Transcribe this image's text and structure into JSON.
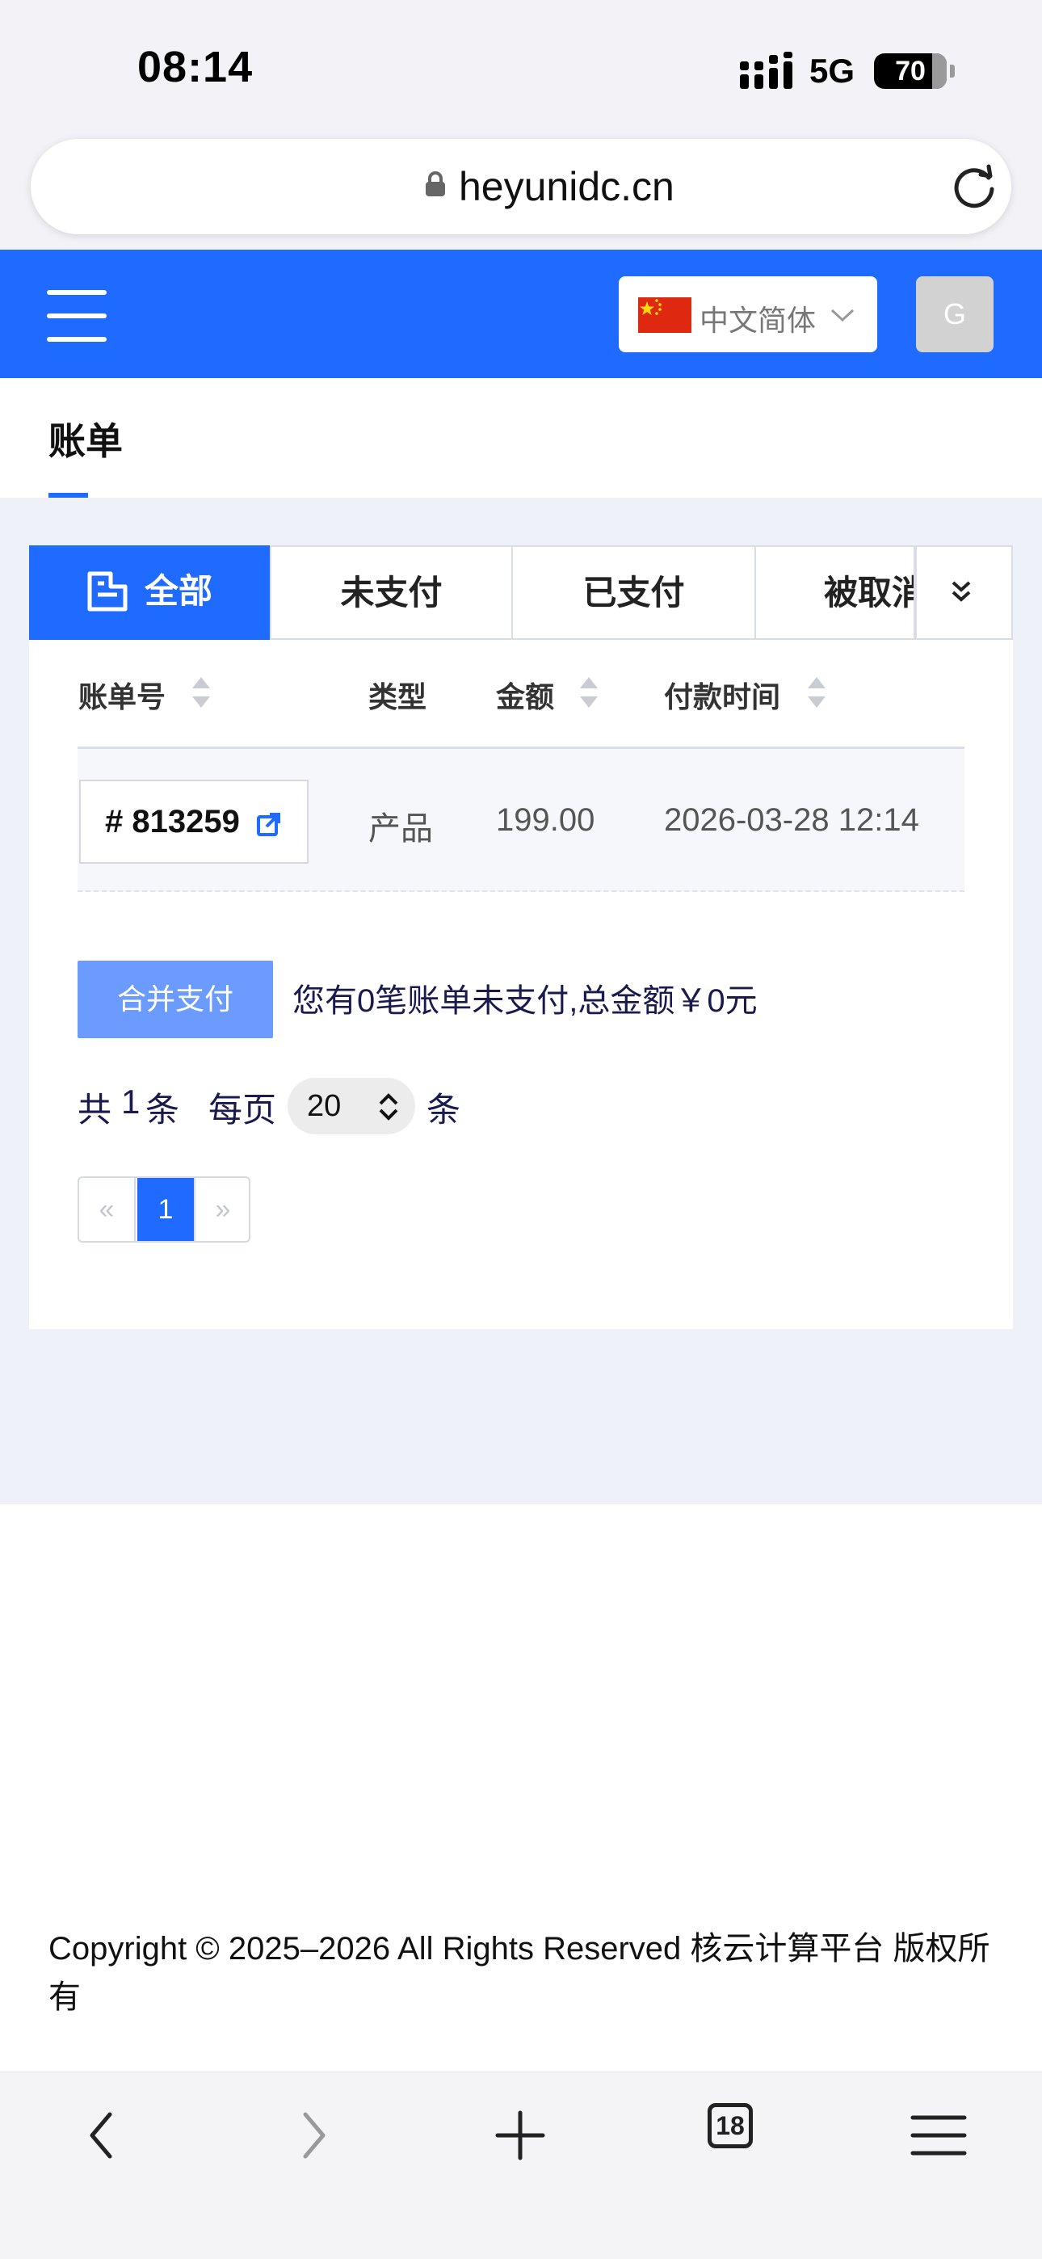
{
  "status_bar": {
    "time": "08:14",
    "network": "5G",
    "battery": "70"
  },
  "browser": {
    "url": "heyunidc.cn",
    "tab_count": "18"
  },
  "header": {
    "language": "中文简体",
    "avatar_initial": "G"
  },
  "page": {
    "title": "账单"
  },
  "tabs": [
    {
      "label": "全部",
      "active": true
    },
    {
      "label": "未支付",
      "active": false
    },
    {
      "label": "已支付",
      "active": false
    },
    {
      "label": "被取消",
      "active": false
    }
  ],
  "table": {
    "headers": {
      "bill_no": "账单号",
      "type": "类型",
      "amount": "金额",
      "pay_time": "付款时间"
    },
    "rows": [
      {
        "bill_no": "# 813259",
        "type": "产品",
        "amount": "199.00",
        "pay_time": "2026-03-28 12:14"
      }
    ]
  },
  "summary": {
    "merge_button": "合并支付",
    "unpaid_note": "您有0笔账单未支付,总金额￥0元"
  },
  "pagination": {
    "total_prefix": "共",
    "total": "1",
    "total_suffix": "条",
    "per_page_label": "每页",
    "per_page": "20",
    "per_page_suffix": "条",
    "prev": "«",
    "current": "1",
    "next": "»"
  },
  "footer": {
    "copyright": "Copyright © 2025–2026 All Rights Reserved 核云计算平台 版权所有"
  },
  "colors": {
    "primary": "#1f6bff",
    "merge_button": "#6b9bff",
    "content_bg": "#eef1f8"
  },
  "icons": [
    "lock-icon",
    "reload-icon",
    "menu-icon",
    "china-flag-icon",
    "chevron-down-icon",
    "bill-icon",
    "double-chevron-down-icon",
    "sort-icon",
    "external-link-icon",
    "back-icon",
    "forward-icon",
    "new-tab-icon",
    "tabs-icon",
    "browser-menu-icon"
  ]
}
